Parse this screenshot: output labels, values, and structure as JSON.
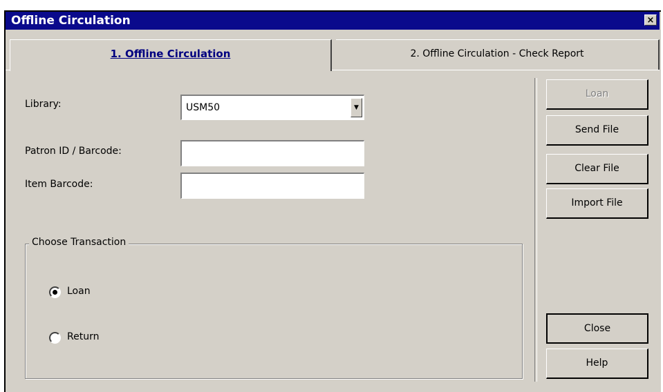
{
  "window": {
    "title": "Offline Circulation",
    "close_glyph": "×"
  },
  "tabs": [
    {
      "label": "1. Offline Circulation",
      "active": true
    },
    {
      "label": "2. Offline Circulation - Check Report",
      "active": false
    }
  ],
  "form": {
    "library_label": "Library:",
    "library_value": "USM50",
    "patron_label": "Patron ID / Barcode:",
    "patron_value": "",
    "item_label": "Item Barcode:",
    "item_value": ""
  },
  "transaction": {
    "legend": "Choose Transaction",
    "options": [
      {
        "label": "Loan",
        "selected": true
      },
      {
        "label": "Return",
        "selected": false
      }
    ]
  },
  "buttons": {
    "loan": "Loan",
    "send_file": "Send File",
    "clear_file": "Clear File",
    "import_file": "Import File",
    "close": "Close",
    "help": "Help"
  },
  "colors": {
    "titlebar": "#0a0a8c",
    "face": "#d4d0c8",
    "active_tab_text": "#000080"
  }
}
